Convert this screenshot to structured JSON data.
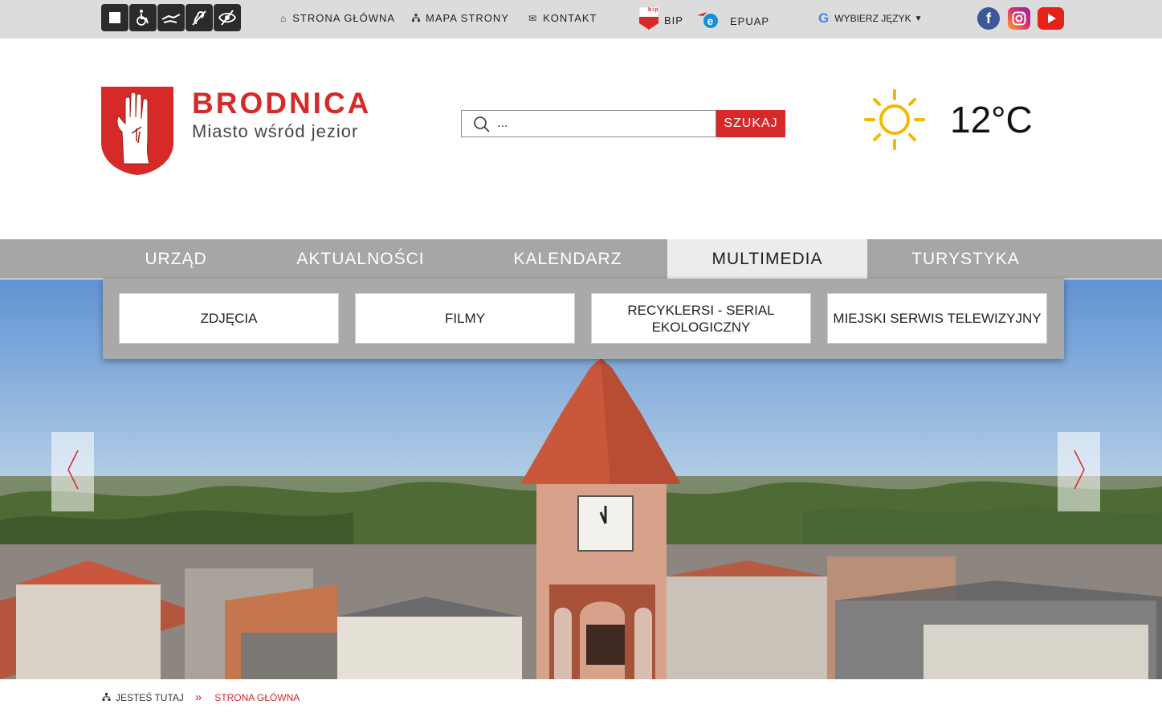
{
  "topbar": {
    "accessibility": [
      {
        "icon": "contrast-square-icon"
      },
      {
        "icon": "wheelchair-icon"
      },
      {
        "icon": "sign-language-icon"
      },
      {
        "icon": "hearing-impaired-icon"
      },
      {
        "icon": "visually-impaired-icon"
      }
    ],
    "links": [
      {
        "label": "STRONA GŁÓWNA",
        "icon": "home-icon"
      },
      {
        "label": "MAPA STRONY",
        "icon": "sitemap-icon"
      },
      {
        "label": "KONTAKT",
        "icon": "envelope-icon"
      }
    ],
    "bip_label": "BIP",
    "bip_badge": "bip",
    "epuap_label": "EPUAP",
    "language_label": "WYBIERZ JĘZYK",
    "social": [
      {
        "icon": "facebook-icon",
        "color": "#3b5998"
      },
      {
        "icon": "instagram-icon",
        "color": "#e1306c"
      },
      {
        "icon": "youtube-icon",
        "color": "#e62117"
      }
    ]
  },
  "header": {
    "brand_name": "BRODNICA",
    "brand_tagline": "Miasto wśród jezior",
    "search_placeholder": "...",
    "search_button": "SZUKAJ",
    "weather_icon": "sun-icon",
    "temperature": "12°C"
  },
  "nav": {
    "items": [
      {
        "label": "URZĄD",
        "active": false
      },
      {
        "label": "AKTUALNOŚCI",
        "active": false
      },
      {
        "label": "KALENDARZ",
        "active": false
      },
      {
        "label": "MULTIMEDIA",
        "active": true
      },
      {
        "label": "TURYSTYKA",
        "active": false
      }
    ]
  },
  "dropdown": {
    "items": [
      {
        "label": "ZDJĘCIA"
      },
      {
        "label": "FILMY"
      },
      {
        "label": "RECYKLERSI - SERIAL EKOLOGICZNY"
      },
      {
        "label": "MIEJSKI SERWIS TELEWIZYJNY"
      }
    ]
  },
  "breadcrumb": {
    "prefix": "JESTEŚ TUTAJ",
    "separator": "»",
    "current": "STRONA GŁÓWNA"
  },
  "colors": {
    "brand_red": "#d52a27",
    "topbar_bg": "#dcdcdc",
    "nav_bg": "#a6a6a6",
    "nav_active_bg": "#ececec"
  }
}
